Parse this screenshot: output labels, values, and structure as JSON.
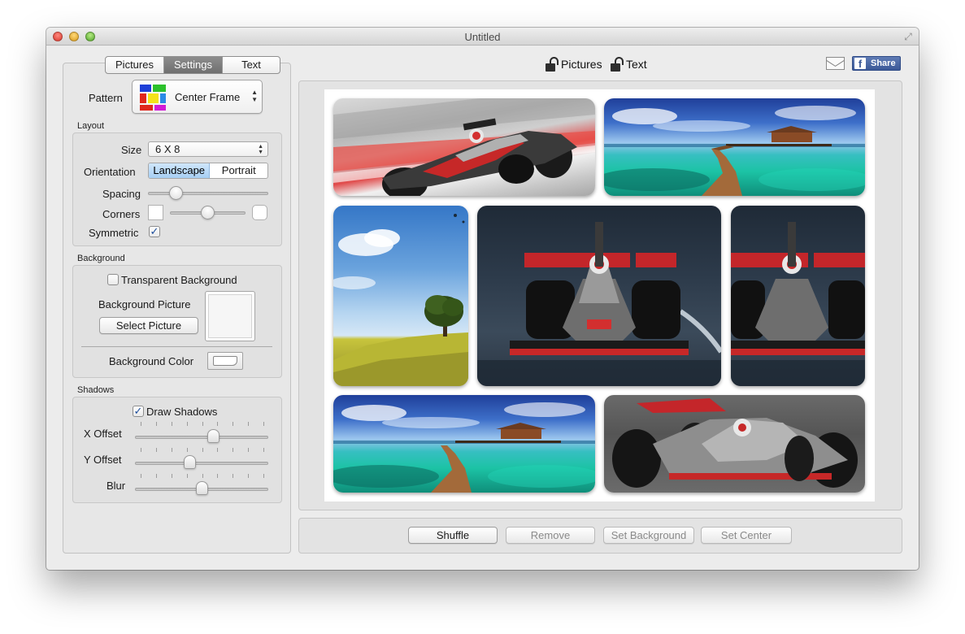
{
  "window": {
    "title": "Untitled"
  },
  "tabs": [
    {
      "label": "Pictures",
      "active": false
    },
    {
      "label": "Settings",
      "active": true
    },
    {
      "label": "Text",
      "active": false
    }
  ],
  "pattern": {
    "label": "Pattern",
    "value": "Center Frame"
  },
  "layout": {
    "section": "Layout",
    "size_label": "Size",
    "size_value": "6 X 8",
    "orientation_label": "Orientation",
    "orientation_options": [
      "Landscape",
      "Portrait"
    ],
    "orientation_selected": "Landscape",
    "spacing_label": "Spacing",
    "spacing_value": 0.2,
    "corners_label": "Corners",
    "corners_value": 0.5,
    "symmetric_label": "Symmetric",
    "symmetric_checked": true
  },
  "background": {
    "section": "Background",
    "transparent_label": "Transparent Background",
    "transparent_checked": false,
    "picture_label": "Background Picture",
    "select_button": "Select Picture",
    "color_label": "Background Color",
    "color_value": "#ffffff"
  },
  "shadows": {
    "section": "Shadows",
    "draw_label": "Draw Shadows",
    "draw_checked": true,
    "x_offset_label": "X Offset",
    "x_offset_value": 0.6,
    "y_offset_label": "Y Offset",
    "y_offset_value": 0.4,
    "blur_label": "Blur",
    "blur_value": 0.5
  },
  "header": {
    "pictures_label": "Pictures",
    "text_label": "Text",
    "share_label": "Share",
    "icons": [
      "unlocked-lock-icon",
      "mail-icon",
      "facebook-icon"
    ]
  },
  "photos": [
    {
      "name": "f1-car-motion-blur"
    },
    {
      "name": "tropical-pier-sea"
    },
    {
      "name": "tree-on-hill-sky"
    },
    {
      "name": "f1-car-front-center"
    },
    {
      "name": "f1-car-front-right"
    },
    {
      "name": "tropical-pier-sea-2"
    },
    {
      "name": "f1-car-track-bottom"
    }
  ],
  "actions": {
    "shuffle": "Shuffle",
    "remove": "Remove",
    "set_background": "Set Background",
    "set_center": "Set Center"
  }
}
